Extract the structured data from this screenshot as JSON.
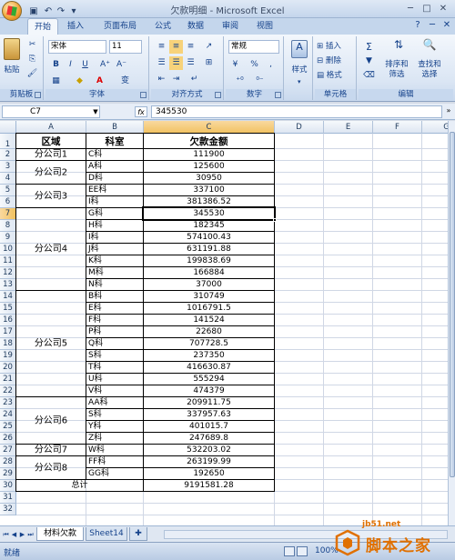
{
  "window": {
    "title": "欠款明细 - Microsoft Excel"
  },
  "ribbon": {
    "tabs": [
      "开始",
      "插入",
      "页面布局",
      "公式",
      "数据",
      "审阅",
      "视图"
    ],
    "clipboard": {
      "paste": "粘贴",
      "label": "剪贴板"
    },
    "font": {
      "family": "宋体",
      "size": "11",
      "label": "字体",
      "bold": "B",
      "italic": "I",
      "underline": "U",
      "grow": "A⁺",
      "shrink": "A⁻",
      "fontcolor": "A",
      "wen": "变"
    },
    "alignment": {
      "label": "对齐方式"
    },
    "number": {
      "format": "常规",
      "label": "数字",
      "percent": "%",
      "comma": ","
    },
    "styles": {
      "label": "样式"
    },
    "cells": {
      "insert": "插入",
      "delete": "删除",
      "format": "格式",
      "label": "单元格"
    },
    "editing": {
      "sort": "排序和",
      "filter": "筛选",
      "find": "查找和",
      "select": "选择",
      "label": "编辑",
      "sigma": "Σ"
    }
  },
  "formula_bar": {
    "cell_ref": "C7",
    "fx": "fx",
    "value": "345530"
  },
  "columns": [
    "A",
    "B",
    "C",
    "D",
    "E",
    "F",
    "G"
  ],
  "rows": [
    "1",
    "2",
    "3",
    "4",
    "5",
    "6",
    "7",
    "8",
    "9",
    "10",
    "11",
    "12",
    "13",
    "14",
    "15",
    "16",
    "17",
    "18",
    "19",
    "20",
    "21",
    "22",
    "23",
    "24",
    "25",
    "26",
    "27",
    "28",
    "29",
    "30",
    "31",
    "32"
  ],
  "table": {
    "headers": [
      "区域",
      "科室",
      "欠款金额"
    ],
    "groups": [
      {
        "name": "分公司1",
        "start": 2,
        "end": 2
      },
      {
        "name": "分公司2",
        "start": 3,
        "end": 4
      },
      {
        "name": "分公司3",
        "start": 5,
        "end": 6
      },
      {
        "name": "分公司4",
        "start": 7,
        "end": 13
      },
      {
        "name": "分公司5",
        "start": 14,
        "end": 22
      },
      {
        "name": "分公司6",
        "start": 23,
        "end": 26
      },
      {
        "name": "分公司7",
        "start": 27,
        "end": 27
      },
      {
        "name": "分公司8",
        "start": 28,
        "end": 29
      }
    ],
    "rows": [
      {
        "dept": "C科",
        "amount": "111900"
      },
      {
        "dept": "A科",
        "amount": "125600"
      },
      {
        "dept": "D科",
        "amount": "30950"
      },
      {
        "dept": "EE科",
        "amount": "337100"
      },
      {
        "dept": "I科",
        "amount": "381386.52"
      },
      {
        "dept": "G科",
        "amount": "345530"
      },
      {
        "dept": "H科",
        "amount": "182345"
      },
      {
        "dept": "I科",
        "amount": "574100.43"
      },
      {
        "dept": "J科",
        "amount": "631191.88"
      },
      {
        "dept": "K科",
        "amount": "199838.69"
      },
      {
        "dept": "M科",
        "amount": "166884"
      },
      {
        "dept": "N科",
        "amount": "37000"
      },
      {
        "dept": "B科",
        "amount": "310749"
      },
      {
        "dept": "E科",
        "amount": "1016791.5"
      },
      {
        "dept": "F科",
        "amount": "141524"
      },
      {
        "dept": "P科",
        "amount": "22680"
      },
      {
        "dept": "Q科",
        "amount": "707728.5"
      },
      {
        "dept": "S科",
        "amount": "237350"
      },
      {
        "dept": "T科",
        "amount": "416630.87"
      },
      {
        "dept": "U科",
        "amount": "555294"
      },
      {
        "dept": "V科",
        "amount": "474379"
      },
      {
        "dept": "AA科",
        "amount": "209911.75"
      },
      {
        "dept": "S科",
        "amount": "337957.63"
      },
      {
        "dept": "Y科",
        "amount": "401015.7"
      },
      {
        "dept": "Z科",
        "amount": "247689.8"
      },
      {
        "dept": "W科",
        "amount": "532203.02"
      },
      {
        "dept": "FF科",
        "amount": "263199.99"
      },
      {
        "dept": "GG科",
        "amount": "192650"
      }
    ],
    "total_label": "总计",
    "total_amount": "9191581.28"
  },
  "sheets": [
    "材料欠款",
    "Sheet14"
  ],
  "active_sheet": "材料欠款",
  "status": "就绪",
  "zoom": "100%",
  "watermark": {
    "url": "jb51.net",
    "text": "脚本之家"
  },
  "colors": {
    "accent": "#15428b",
    "ribbon": "#dbe6f4",
    "selection": "#f1c15f",
    "watermark": "#e07000"
  }
}
